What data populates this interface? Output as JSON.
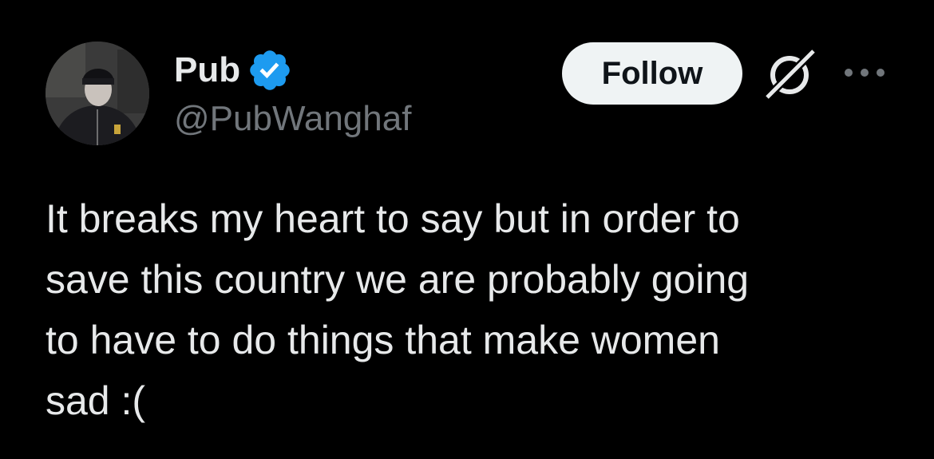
{
  "author": {
    "display_name": "Pub",
    "handle": "@PubWanghaf",
    "avatar_icon": "user-avatar",
    "verified_icon": "verified-badge-icon",
    "verified_color": "#1d9bf0"
  },
  "actions": {
    "follow_label": "Follow",
    "grok_icon": "grok-icon",
    "more_icon": "more-options-icon"
  },
  "tweet": {
    "text": "It breaks my heart to say but in order to\nsave this country we are probably going\nto have to do things that make women\nsad :("
  },
  "colors": {
    "background": "#000000",
    "primary_text": "#e7e9ea",
    "secondary_text": "#71767b",
    "follow_bg": "#eff3f4"
  }
}
